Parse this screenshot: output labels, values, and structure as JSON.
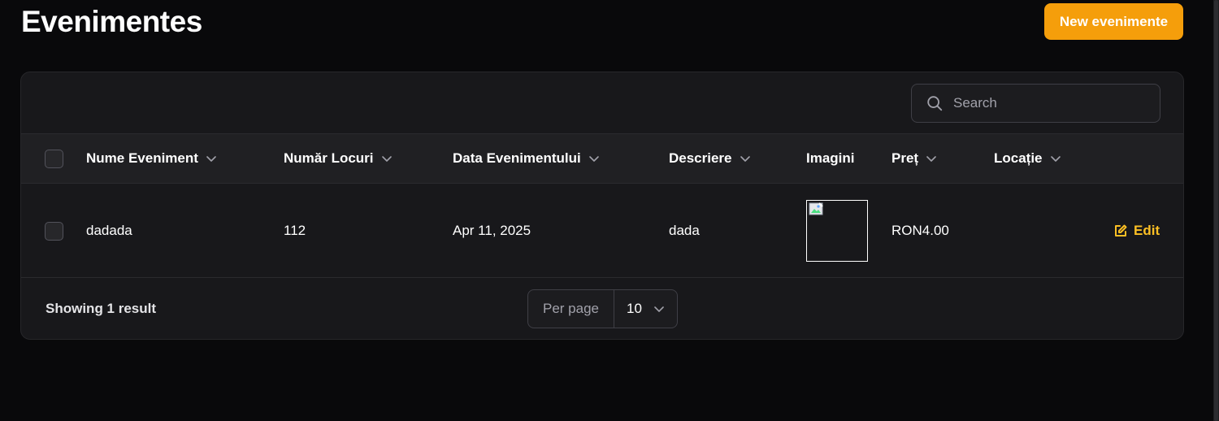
{
  "header": {
    "title": "Evenimentes",
    "new_button_label": "New evenimente"
  },
  "search": {
    "placeholder": "Search",
    "value": ""
  },
  "table": {
    "columns": [
      {
        "label": "Nume Eveniment",
        "sortable": true
      },
      {
        "label": "Număr Locuri",
        "sortable": true
      },
      {
        "label": "Data Evenimentului",
        "sortable": true
      },
      {
        "label": "Descriere",
        "sortable": true
      },
      {
        "label": "Imagini",
        "sortable": false
      },
      {
        "label": "Preț",
        "sortable": true
      },
      {
        "label": "Locație",
        "sortable": true
      }
    ],
    "rows": [
      {
        "nume": "dadada",
        "locuri": "112",
        "data": "Apr 11, 2025",
        "descriere": "dada",
        "imagine": "broken-image-icon",
        "pret": "RON4.00",
        "locatie": "",
        "action_label": "Edit"
      }
    ]
  },
  "footer": {
    "result_text": "Showing 1 result",
    "per_page_label": "Per page",
    "per_page_value": "10"
  },
  "colors": {
    "background": "#09090b",
    "card": "#18181b",
    "accent": "#f59e0b",
    "edit_link": "#fbbf24"
  }
}
